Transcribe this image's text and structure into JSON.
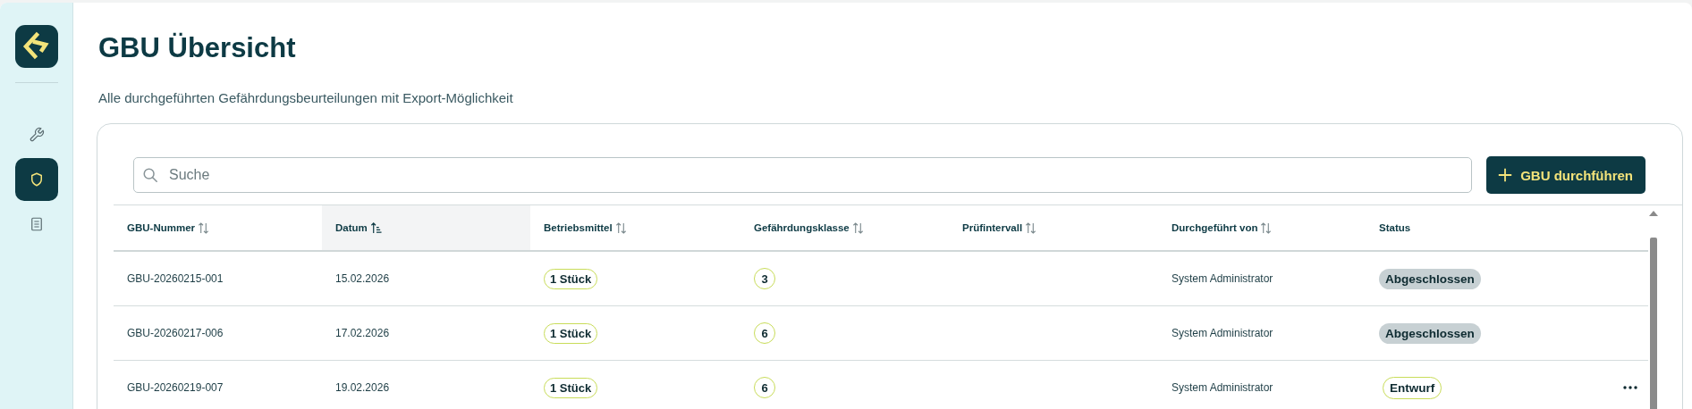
{
  "sidebar": {
    "items": [
      {
        "kind": "wrench",
        "selected": false
      },
      {
        "kind": "shield",
        "selected": true
      },
      {
        "kind": "document",
        "selected": false
      }
    ]
  },
  "page": {
    "title": "GBU Übersicht",
    "subtitle": "Alle durchgeführten Gefährdungsbeurteilungen mit Export-Möglichkeit"
  },
  "search": {
    "placeholder": "Suche"
  },
  "add_button": {
    "label": "GBU durchführen"
  },
  "table": {
    "columns": [
      {
        "label": "GBU-Nummer",
        "sortable": true,
        "sorted": false
      },
      {
        "label": "Datum",
        "sortable": true,
        "sorted": true
      },
      {
        "label": "Betriebsmittel",
        "sortable": true,
        "sorted": false
      },
      {
        "label": "Gefährdungsklasse",
        "sortable": true,
        "sorted": false
      },
      {
        "label": "Prüfintervall",
        "sortable": true,
        "sorted": false
      },
      {
        "label": "Durchgeführt von",
        "sortable": true,
        "sorted": false
      },
      {
        "label": "Status",
        "sortable": false,
        "sorted": false
      }
    ],
    "rows": [
      {
        "number": "GBU-20260215-001",
        "date": "15.02.2026",
        "equipment": "1 Stück",
        "hazard_class": "3",
        "by": "System Administrator",
        "status": {
          "label": "Abgeschlossen",
          "kind": "completed"
        },
        "menu_visible": false
      },
      {
        "number": "GBU-20260217-006",
        "date": "17.02.2026",
        "equipment": "1 Stück",
        "hazard_class": "6",
        "by": "System Administrator",
        "status": {
          "label": "Abgeschlossen",
          "kind": "completed"
        },
        "menu_visible": false
      },
      {
        "number": "GBU-20260219-007",
        "date": "19.02.2026",
        "equipment": "1 Stück",
        "hazard_class": "6",
        "by": "System Administrator",
        "status": {
          "label": "Entwurf",
          "kind": "draft"
        },
        "menu_visible": true
      }
    ]
  }
}
